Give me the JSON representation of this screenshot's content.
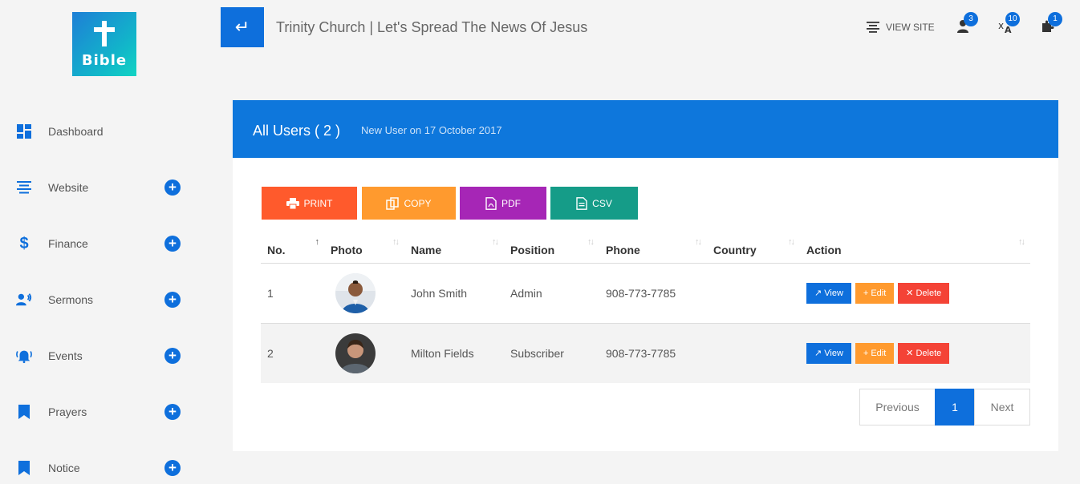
{
  "logo": {
    "text": "Bible"
  },
  "sidebar": {
    "items": [
      {
        "label": "Dashboard",
        "icon": "dashboard-icon",
        "expandable": false
      },
      {
        "label": "Website",
        "icon": "align-center-icon",
        "expandable": true
      },
      {
        "label": "Finance",
        "icon": "dollar-icon",
        "expandable": true
      },
      {
        "label": "Sermons",
        "icon": "speaker-person-icon",
        "expandable": true
      },
      {
        "label": "Events",
        "icon": "bell-ring-icon",
        "expandable": true
      },
      {
        "label": "Prayers",
        "icon": "bookmark-icon",
        "expandable": true
      },
      {
        "label": "Notice",
        "icon": "bookmark-icon",
        "expandable": true
      }
    ]
  },
  "header": {
    "back_symbol": "↵",
    "title": "Trinity Church | Let's Spread The News Of Jesus",
    "view_site": "VIEW SITE",
    "badges": {
      "users": "3",
      "translate": "10",
      "plugins": "1"
    }
  },
  "panel": {
    "title": "All Users ( 2 )",
    "subtitle": "New User on 17 October 2017"
  },
  "export": {
    "print": "PRINT",
    "copy": "COPY",
    "pdf": "PDF",
    "csv": "CSV"
  },
  "table": {
    "headers": [
      "No.",
      "Photo",
      "Name",
      "Position",
      "Phone",
      "Country",
      "Action"
    ],
    "rows": [
      {
        "no": "1",
        "name": "John Smith",
        "position": "Admin",
        "phone": "908-773-7785",
        "country": ""
      },
      {
        "no": "2",
        "name": "Milton Fields",
        "position": "Subscriber",
        "phone": "908-773-7785",
        "country": ""
      }
    ],
    "actions": {
      "view": "View",
      "edit": "Edit",
      "delete": "Delete"
    }
  },
  "pagination": {
    "previous": "Previous",
    "page": "1",
    "next": "Next"
  },
  "colors": {
    "primary": "#0e6fdc",
    "print": "#ff5a2c",
    "copy": "#ff9a2e",
    "pdf": "#a626b6",
    "csv": "#159c88",
    "delete": "#f44336"
  }
}
